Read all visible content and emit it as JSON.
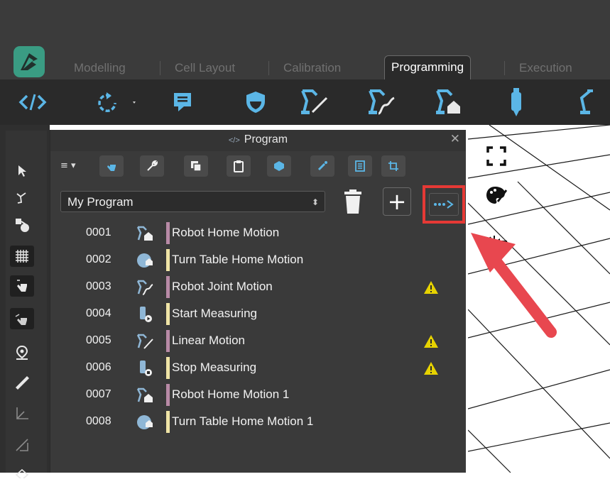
{
  "tabs": [
    {
      "label": "Modelling",
      "active": false
    },
    {
      "label": "Cell Layout",
      "active": false
    },
    {
      "label": "Calibration",
      "active": false
    },
    {
      "label": "Programming",
      "active": true
    },
    {
      "label": "Execution",
      "active": false
    }
  ],
  "main_toolbar_icons": [
    "code-icon",
    "rotate-dropdown-icon",
    "comment-icon",
    "shield-icon",
    "robot-linear-icon",
    "robot-joint-icon",
    "robot-home-icon",
    "probe-icon",
    "robot-arm-icon"
  ],
  "left_toolbar_icons": [
    "pointer-icon",
    "robot-icon",
    "parts-icon",
    "grid-icon",
    "hand-select-icon",
    "hand-pick-icon",
    "location-icon",
    "ruler-icon",
    "axis-icon",
    "sketch-icon",
    "target-icon"
  ],
  "panel": {
    "title": "Program",
    "close_glyph": "✕",
    "menu_glyph": "≡ ▾",
    "tool_icons": [
      "teach-icon",
      "wrench-icon",
      "copy-icon",
      "clipboard-icon",
      "box-icon",
      "brush-icon",
      "list-icon",
      "crop-icon"
    ],
    "program_select": {
      "value": "My Program"
    },
    "add_glyph": "+",
    "more_glyph": "•••▷"
  },
  "program_rows": [
    {
      "num": "0001",
      "name": "Robot Home Motion",
      "icon": "robot-home-icon",
      "bar_color": "#b88aa6",
      "warning": false
    },
    {
      "num": "0002",
      "name": "Turn Table Home Motion",
      "icon": "turntable-icon",
      "bar_color": "#efe4a6",
      "warning": false
    },
    {
      "num": "0003",
      "name": "Robot Joint Motion",
      "icon": "robot-joint-icon",
      "bar_color": "#b88aa6",
      "warning": true
    },
    {
      "num": "0004",
      "name": "Start Measuring",
      "icon": "probe-start-icon",
      "bar_color": "#efe4a6",
      "warning": false
    },
    {
      "num": "0005",
      "name": "Linear Motion",
      "icon": "robot-linear-icon",
      "bar_color": "#b88aa6",
      "warning": true
    },
    {
      "num": "0006",
      "name": "Stop Measuring",
      "icon": "probe-stop-icon",
      "bar_color": "#efe4a6",
      "warning": true
    },
    {
      "num": "0007",
      "name": "Robot Home Motion 1",
      "icon": "robot-home-icon",
      "bar_color": "#b88aa6",
      "warning": false
    },
    {
      "num": "0008",
      "name": "Turn Table Home Motion 1",
      "icon": "turntable-icon",
      "bar_color": "#efe4a6",
      "warning": false
    }
  ],
  "viewport_tools": [
    "fit-view-icon",
    "paint-icon",
    "click-target-icon"
  ],
  "colors": {
    "accent_highlight": "#e53935",
    "annotation_arrow": "#e8474f",
    "warning": "#e6d200",
    "app_logo": "#3a9c83"
  }
}
